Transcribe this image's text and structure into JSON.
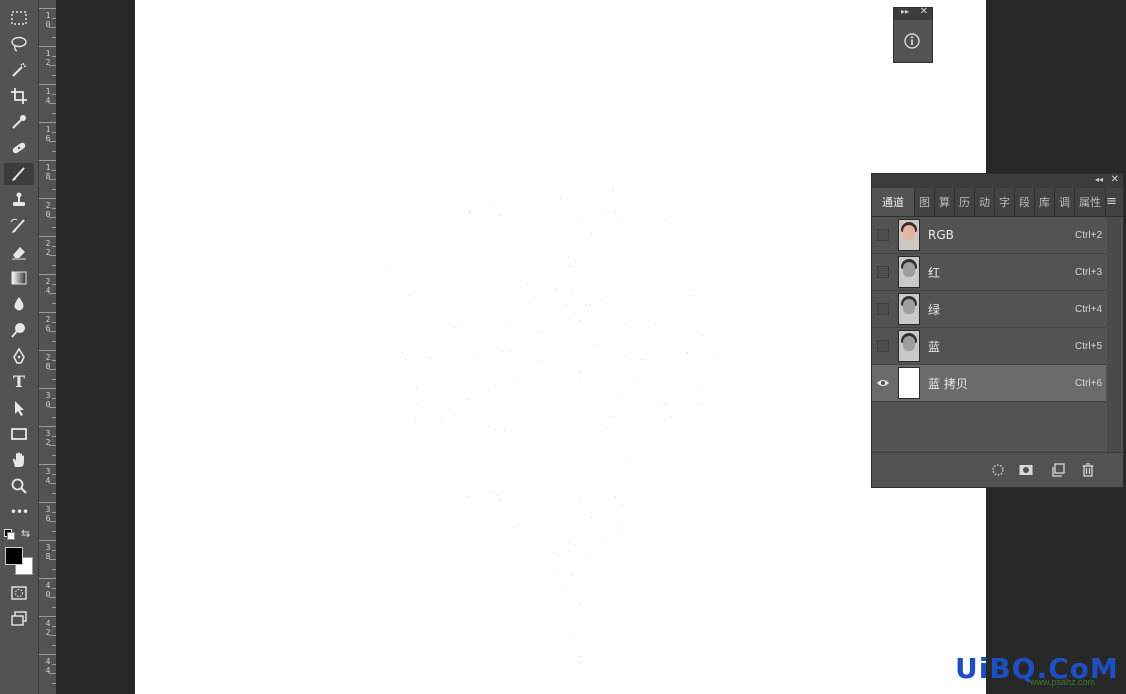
{
  "toolbar": {
    "tools": [
      {
        "name": "rectangular-marquee-icon"
      },
      {
        "name": "lasso-icon"
      },
      {
        "name": "magic-wand-icon"
      },
      {
        "name": "crop-icon"
      },
      {
        "name": "eyedropper-icon"
      },
      {
        "name": "healing-brush-icon"
      },
      {
        "name": "brush-icon",
        "active": true
      },
      {
        "name": "clone-stamp-icon"
      },
      {
        "name": "history-brush-icon"
      },
      {
        "name": "eraser-icon"
      },
      {
        "name": "gradient-icon"
      },
      {
        "name": "blur-icon"
      },
      {
        "name": "dodge-icon"
      },
      {
        "name": "pen-icon"
      },
      {
        "name": "type-icon",
        "glyph": "T"
      },
      {
        "name": "path-selection-icon"
      },
      {
        "name": "rectangle-icon"
      },
      {
        "name": "hand-icon"
      },
      {
        "name": "zoom-icon"
      },
      {
        "name": "more-tools-icon",
        "glyph": "•••"
      }
    ],
    "foreground_color": "#000000",
    "background_color": "#ffffff"
  },
  "ruler": {
    "labels": [
      "1\n0",
      "1\n2",
      "1\n4",
      "1\n6",
      "1\n8",
      "2\n0",
      "2\n2",
      "2\n4",
      "2\n6",
      "2\n8",
      "3\n0",
      "3\n2",
      "3\n4",
      "3\n6",
      "3\n8",
      "4\n0",
      "4\n2",
      "4\n4"
    ]
  },
  "channels_panel": {
    "tabs": [
      "通道",
      "图",
      "算",
      "历",
      "动",
      "字",
      "段",
      "库",
      "调",
      "属性"
    ],
    "channels": [
      {
        "name": "RGB",
        "shortcut": "Ctrl+2",
        "visible": false,
        "thumb": "color"
      },
      {
        "name": "红",
        "shortcut": "Ctrl+3",
        "visible": false,
        "thumb": "gray"
      },
      {
        "name": "绿",
        "shortcut": "Ctrl+4",
        "visible": false,
        "thumb": "gray"
      },
      {
        "name": "蓝",
        "shortcut": "Ctrl+5",
        "visible": false,
        "thumb": "gray"
      },
      {
        "name": "蓝 拷贝",
        "shortcut": "Ctrl+6",
        "visible": true,
        "selected": true,
        "thumb": "white"
      }
    ],
    "footer_icons": [
      "load-selection-icon",
      "save-selection-icon",
      "new-channel-icon",
      "delete-channel-icon"
    ]
  },
  "watermark": {
    "text": "UiBQ.CoM",
    "url": "www.psahz.com"
  },
  "colors": {
    "panel": "#535353",
    "background": "#282828",
    "canvas": "#ffffff",
    "selected_row": "#6b6b6b"
  }
}
